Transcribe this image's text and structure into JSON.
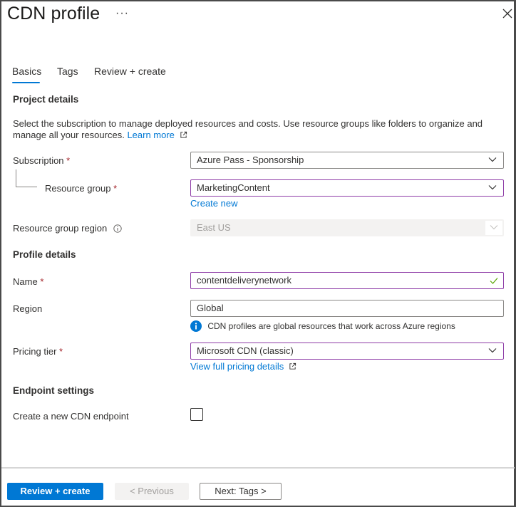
{
  "header": {
    "title": "CDN profile",
    "more_label": "···"
  },
  "tabs": [
    {
      "label": "Basics",
      "active": true
    },
    {
      "label": "Tags",
      "active": false
    },
    {
      "label": "Review + create",
      "active": false
    }
  ],
  "project_details": {
    "heading": "Project details",
    "description": "Select the subscription to manage deployed resources and costs. Use resource groups like folders to organize and manage all your resources.",
    "learn_more": "Learn more",
    "subscription": {
      "label": "Subscription",
      "required": "*",
      "value": "Azure Pass - Sponsorship"
    },
    "resource_group": {
      "label": "Resource group",
      "required": "*",
      "value": "MarketingContent",
      "create_new": "Create new"
    },
    "resource_group_region": {
      "label": "Resource group region",
      "value": "East US"
    }
  },
  "profile_details": {
    "heading": "Profile details",
    "name": {
      "label": "Name",
      "required": "*",
      "value": "contentdeliverynetwork"
    },
    "region": {
      "label": "Region",
      "value": "Global",
      "note": "CDN profiles are global resources that work across Azure regions"
    },
    "pricing_tier": {
      "label": "Pricing tier",
      "required": "*",
      "value": "Microsoft CDN (classic)",
      "details_link": "View full pricing details"
    }
  },
  "endpoint_settings": {
    "heading": "Endpoint settings",
    "create_endpoint": {
      "label": "Create a new CDN endpoint",
      "checked": false
    }
  },
  "footer": {
    "review_create": "Review + create",
    "previous": "< Previous",
    "next": "Next: Tags >"
  },
  "colors": {
    "accent": "#0078d4",
    "focus_border": "#8e3ca7",
    "required": "#a4262c",
    "valid": "#57a300"
  }
}
